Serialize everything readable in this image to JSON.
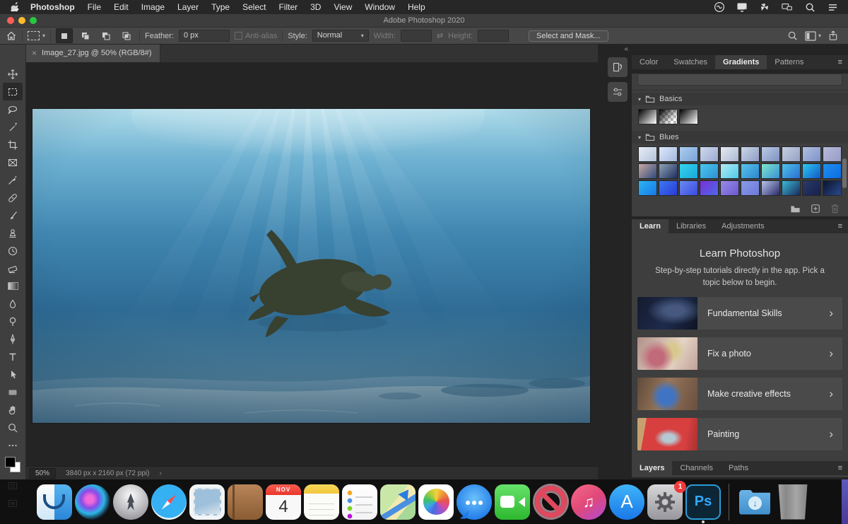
{
  "menu_bar": {
    "items": [
      "Photoshop",
      "File",
      "Edit",
      "Image",
      "Layer",
      "Type",
      "Select",
      "Filter",
      "3D",
      "View",
      "Window",
      "Help"
    ],
    "status_icons": [
      "creative-cloud",
      "display",
      "fan",
      "sidecar",
      "spotlight-search",
      "notification-list"
    ]
  },
  "title_bar": {
    "title": "Adobe Photoshop 2020"
  },
  "options_bar": {
    "tool_preset": "rectangular-marquee",
    "selection_modes": [
      "new-selection",
      "add-to-selection",
      "subtract-from-selection",
      "intersect-selection"
    ],
    "feather_label": "Feather:",
    "feather_value": "0 px",
    "anti_alias_label": "Anti-alias",
    "style_label": "Style:",
    "style_value": "Normal",
    "width_label": "Width:",
    "width_value": "",
    "swap_glyph": "⇄",
    "height_label": "Height:",
    "height_value": "",
    "select_and_mask_label": "Select and Mask..."
  },
  "document": {
    "tab_title": "Image_27.jpg @ 50% (RGB/8#)",
    "close_glyph": "×",
    "zoom_level": "50%",
    "dimensions": "3840 px x 2160 px (72 ppi)",
    "status_chevron": "›",
    "image_description": "sea turtle swimming underwater with sun rays"
  },
  "toolbar": {
    "selected_tool": "rectangular-marquee-tool",
    "tools": [
      "move-tool",
      "rectangular-marquee-tool",
      "lasso-tool",
      "object-selection-tool",
      "crop-tool",
      "frame-tool",
      "eyedropper-tool",
      "spot-healing-brush-tool",
      "brush-tool",
      "clone-stamp-tool",
      "history-brush-tool",
      "eraser-tool",
      "gradient-tool",
      "blur-tool",
      "dodge-tool",
      "pen-tool",
      "type-tool",
      "path-selection-tool",
      "rectangle-tool",
      "hand-tool",
      "zoom-tool",
      "edit-toolbar",
      "foreground-background-colors",
      "quick-mask-mode",
      "screen-mode"
    ]
  },
  "right_panel": {
    "collapse_glyph": "«",
    "collapsed_icons": [
      "history",
      "properties"
    ],
    "top_tabs": [
      "Color",
      "Swatches",
      "Gradients",
      "Patterns"
    ],
    "active_top_tab": "Gradients",
    "panel_menu_glyph": "≡",
    "gradient_groups": [
      {
        "name": "Basics",
        "swatches": [
          "black-to-white",
          "black-to-transparent",
          "black-to-white-soft"
        ]
      },
      {
        "name": "Blues",
        "swatch_colors": [
          [
            "#e8eef6",
            "#b3c2da"
          ],
          [
            "#dce8fa",
            "#a4b8de"
          ],
          [
            "#abcdf0",
            "#7ba3d4"
          ],
          [
            "#cfd8ee",
            "#9dabd0"
          ],
          [
            "#e6ebf2",
            "#aab8d2"
          ],
          [
            "#ccd6e8",
            "#8e9ec4"
          ],
          [
            "#b9c8e4",
            "#7f93c0"
          ],
          [
            "#c4cde0",
            "#96a3c4"
          ],
          [
            "#afbfe0",
            "#8093c8"
          ],
          [
            "#b6bad8",
            "#989cc8"
          ],
          [
            "#c9a9a4",
            "#2e4a7c"
          ],
          [
            "#8fa3b8",
            "#1d2f5e"
          ],
          [
            "#35d2ee",
            "#19a8d8"
          ],
          [
            "#49c8ec",
            "#2e8fd4"
          ],
          [
            "#b2ecf2",
            "#4ecbe8"
          ],
          [
            "#59c4ea",
            "#2b86d0"
          ],
          [
            "#7de8c8",
            "#3b8ed8"
          ],
          [
            "#4fc4e8",
            "#2a6cd0"
          ],
          [
            "#2ec8f0",
            "#1258c8"
          ],
          [
            "#1e90f0",
            "#0c6ce0"
          ],
          [
            "#2ab4f0",
            "#1878e8"
          ],
          [
            "#3a78f0",
            "#2a3ad8"
          ],
          [
            "#6a8af0",
            "#3a4ae0"
          ],
          [
            "#7a30d8",
            "#4a6ae8"
          ],
          [
            "#9a8ae8",
            "#6a5ad0"
          ],
          [
            "#8a9ae8",
            "#6a7ad8"
          ],
          [
            "#b8c4e8",
            "#2a2a6a"
          ],
          [
            "#3ab8d8",
            "#1a2a5a"
          ],
          [
            "#2a3a6a",
            "#16204a"
          ],
          [
            "#0a1430",
            "#2a4a8a"
          ]
        ]
      }
    ],
    "footer_icons": [
      "new-group-folder",
      "new-gradient",
      "delete"
    ],
    "middle_tabs": [
      "Learn",
      "Libraries",
      "Adjustments"
    ],
    "active_middle_tab": "Learn",
    "learn": {
      "heading": "Learn Photoshop",
      "description": "Step-by-step tutorials directly in the app. Pick a topic below to begin.",
      "chevron_glyph": "›",
      "topics": [
        {
          "label": "Fundamental Skills"
        },
        {
          "label": "Fix a photo"
        },
        {
          "label": "Make creative effects"
        },
        {
          "label": "Painting"
        }
      ]
    },
    "bottom_tabs": [
      "Layers",
      "Channels",
      "Paths"
    ],
    "active_bottom_tab": "Layers"
  },
  "dock": {
    "items": [
      "finder",
      "siri",
      "launchpad",
      "safari",
      "mail",
      "contacts",
      "calendar",
      "notes",
      "reminders",
      "maps",
      "photos",
      "messages",
      "facetime",
      "prohibited",
      "music",
      "app-store",
      "system-preferences",
      "photoshop",
      "downloads",
      "trash"
    ],
    "running_apps": [
      "finder",
      "photoshop"
    ],
    "calendar_month": "NOV",
    "calendar_day": "4",
    "system_preferences_badge": "1",
    "photoshop_label": "Ps",
    "app_store_letter": "A",
    "music_glyph": "♫"
  },
  "colors": {
    "ps_blue": "#31a8ff",
    "panel_bg": "#3e3e3e",
    "canvas_bg": "#242424",
    "badge_red": "#ee3b3b"
  }
}
